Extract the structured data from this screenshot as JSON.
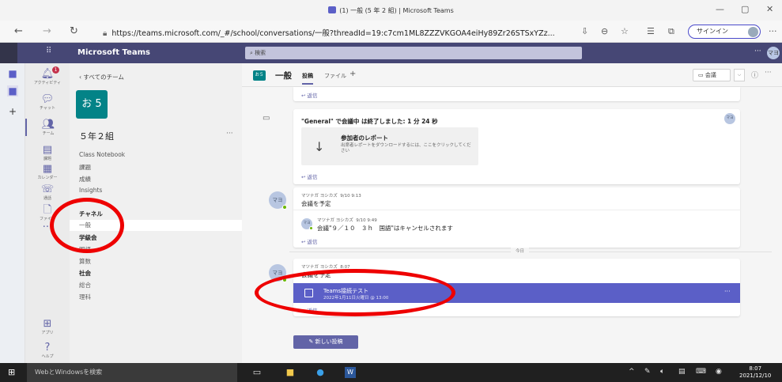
{
  "window": {
    "title": "(1) 一般 (5 年 2 組) | Microsoft Teams",
    "controls": [
      "—",
      "▢",
      "✕"
    ]
  },
  "browser": {
    "url": "https://teams.microsoft.com/_#/school/conversations/一般?threadId=19:c7cm1ML8ZZZVKGOA4eiHy89Zr26STSxYZz...",
    "signin_label": "サインイン",
    "more": "···"
  },
  "teams_header": {
    "app_name": "Microsoft Teams",
    "search_placeholder": "検索",
    "dots": "···",
    "avatar_initials": "マヨ"
  },
  "rail": {
    "items": [
      {
        "label": "アクティビティ",
        "badge": "1"
      },
      {
        "label": "チャット"
      },
      {
        "label": "チーム"
      },
      {
        "label": "課題"
      },
      {
        "label": "カレンダー"
      },
      {
        "label": "通話"
      },
      {
        "label": "ファイル"
      },
      {
        "label": "アプリ"
      },
      {
        "label": "ヘルプ"
      }
    ]
  },
  "team_pane": {
    "back_label": "すべてのチーム",
    "team_avatar": "お 5",
    "team_name": "５年２組",
    "more": "···",
    "links": [
      "Class Notebook",
      "課題",
      "成績",
      "Insights"
    ],
    "channels_heading": "チャネル",
    "channels": [
      {
        "name": "一般",
        "selected": true,
        "bold": false
      },
      {
        "name": "学級会",
        "selected": false,
        "bold": true
      },
      {
        "name": "国語",
        "selected": false,
        "bold": false
      },
      {
        "name": "算数",
        "selected": false,
        "bold": false
      },
      {
        "name": "社会",
        "selected": false,
        "bold": true
      },
      {
        "name": "総合",
        "selected": false,
        "bold": false
      },
      {
        "name": "理科",
        "selected": false,
        "bold": false
      }
    ]
  },
  "channel_header": {
    "avatar": "お５",
    "channel_name": "一般",
    "tabs": [
      "投稿",
      "ファイル",
      "+"
    ],
    "meet_label": "会議",
    "dropdown": "⌵",
    "info": "ⓘ",
    "more": "···"
  },
  "posts": {
    "reply_label": "返信",
    "meeting_ended": {
      "text": "\"General\" で会議中 は終了しました: 1 分 24 秒",
      "report_title": "参加者のレポート",
      "report_desc": "出席者レポートをダウンロードするには、ここをクリックしてください"
    },
    "post1": {
      "author": "マツナガ ヨシカズ",
      "time": "9/10 9:13",
      "body": "会議を予定",
      "avatar": "マヨ",
      "reply": {
        "author": "マツナガ ヨシカズ",
        "time": "9/10 9:49",
        "body": "会議\"９／１０　３ｈ　国語\"はキャンセルされます",
        "avatar": "マヨ"
      }
    },
    "today_label": "今日",
    "post2": {
      "author": "マツナガ ヨシカズ",
      "time": "8:07",
      "body": "会議を予定",
      "avatar": "マヨ",
      "event_title": "Teams接続テスト",
      "event_date": "2022年1月11日火曜日 @ 13:00",
      "event_more": "···"
    },
    "new_post_label": "新しい投稿"
  },
  "taskbar": {
    "search_placeholder": "WebとWindowsを検索",
    "time": "8:07",
    "date": "2021/12/10"
  },
  "colors": {
    "teams_purple": "#6264a7",
    "header": "#464775",
    "annotation_red": "#ee0000",
    "team_teal": "#038387"
  }
}
